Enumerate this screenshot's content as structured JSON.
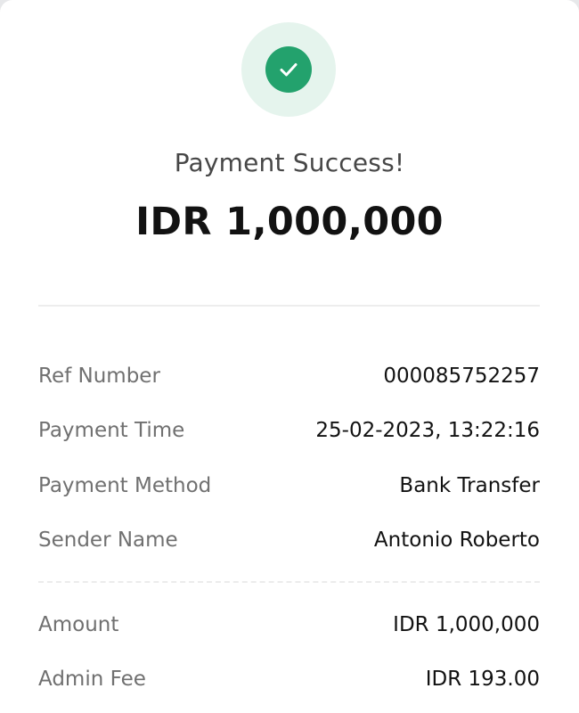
{
  "receipt": {
    "status_title": "Payment Success!",
    "amount_display": "IDR 1,000,000",
    "details": [
      {
        "label": "Ref Number",
        "value": "000085752257"
      },
      {
        "label": "Payment Time",
        "value": "25-02-2023, 13:22:16"
      },
      {
        "label": "Payment Method",
        "value": "Bank Transfer"
      },
      {
        "label": "Sender Name",
        "value": "Antonio Roberto"
      }
    ],
    "fees": [
      {
        "label": "Amount",
        "value": "IDR 1,000,000"
      },
      {
        "label": "Admin Fee",
        "value": "IDR 193.00"
      }
    ]
  },
  "colors": {
    "success_green": "#23a26d",
    "success_green_light": "#e5f4ed",
    "label_gray": "#707070",
    "value_dark": "#121212"
  },
  "icons": {
    "status": "check-circle-icon"
  }
}
